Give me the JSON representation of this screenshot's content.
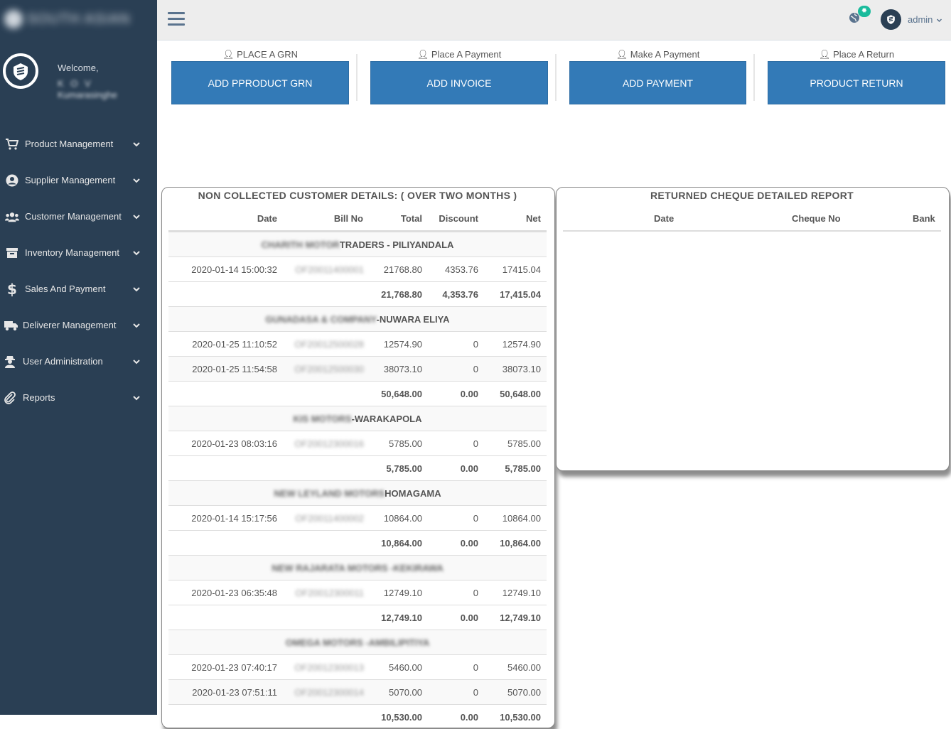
{
  "sidebar": {
    "brand": "SOUTH ASIAN",
    "welcome": "Welcome,",
    "user_line1": "K O V",
    "user_line2": "Kumarasinghe",
    "items": [
      {
        "label": "Product Management"
      },
      {
        "label": "Supplier Management"
      },
      {
        "label": "Customer Management"
      },
      {
        "label": "Inventory Management"
      },
      {
        "label": "Sales And Payment"
      },
      {
        "label": "Deliverer Management"
      },
      {
        "label": "User Administration"
      },
      {
        "label": "Reports"
      }
    ]
  },
  "topbar": {
    "user": "admin",
    "notif_count": "✹"
  },
  "actions": [
    {
      "title": "PLACE A GRN",
      "button": "ADD PPRODUCT GRN"
    },
    {
      "title": "Place A Payment",
      "button": "ADD INVOICE"
    },
    {
      "title": "Make A Payment",
      "button": "ADD PAYMENT"
    },
    {
      "title": "Place A Return",
      "button": "PRODUCT RETURN"
    }
  ],
  "customers_panel": {
    "title": "NON COLLECTED CUSTOMER DETAILS: ( OVER TWO MONTHS )",
    "columns": [
      "Date",
      "Bill No",
      "Total",
      "Discount",
      "Net"
    ],
    "groups": [
      {
        "blur": "CHARITH MOTOR",
        "name": "TRADERS - PILIYANDALA",
        "rows": [
          {
            "date": "2020-01-14 15:00:32",
            "bill": "OF20011400001",
            "total": "21768.80",
            "discount": "4353.76",
            "net": "17415.04"
          }
        ],
        "sum": {
          "total": "21,768.80",
          "discount": "4,353.76",
          "net": "17,415.04"
        }
      },
      {
        "blur": "GUNADASA & COMPANY",
        "name": "-NUWARA ELIYA",
        "rows": [
          {
            "date": "2020-01-25 11:10:52",
            "bill": "OF20012500028",
            "total": "12574.90",
            "discount": "0",
            "net": "12574.90"
          },
          {
            "date": "2020-01-25 11:54:58",
            "bill": "OF20012500030",
            "total": "38073.10",
            "discount": "0",
            "net": "38073.10"
          }
        ],
        "sum": {
          "total": "50,648.00",
          "discount": "0.00",
          "net": "50,648.00"
        }
      },
      {
        "blur": "KIS MOTORS",
        "name": "-WARAKAPOLA",
        "rows": [
          {
            "date": "2020-01-23 08:03:16",
            "bill": "OF20012300016",
            "total": "5785.00",
            "discount": "0",
            "net": "5785.00"
          }
        ],
        "sum": {
          "total": "5,785.00",
          "discount": "0.00",
          "net": "5,785.00"
        }
      },
      {
        "blur": "NEW LEYLAND MOTORS",
        "name": "HOMAGAMA",
        "rows": [
          {
            "date": "2020-01-14 15:17:56",
            "bill": "OF20011400002",
            "total": "10864.00",
            "discount": "0",
            "net": "10864.00"
          }
        ],
        "sum": {
          "total": "10,864.00",
          "discount": "0.00",
          "net": "10,864.00"
        }
      },
      {
        "blur": "NEW RAJARATA MOTORS -KEKIRAWA",
        "name": "",
        "rows": [
          {
            "date": "2020-01-23 06:35:48",
            "bill": "OF20012300011",
            "total": "12749.10",
            "discount": "0",
            "net": "12749.10"
          }
        ],
        "sum": {
          "total": "12,749.10",
          "discount": "0.00",
          "net": "12,749.10"
        }
      },
      {
        "blur": "OMEGA MOTORS -AMBILIPITIYA",
        "name": "",
        "rows": [
          {
            "date": "2020-01-23 07:40:17",
            "bill": "OF20012300013",
            "total": "5460.00",
            "discount": "0",
            "net": "5460.00"
          },
          {
            "date": "2020-01-23 07:51:11",
            "bill": "OF20012300014",
            "total": "5070.00",
            "discount": "0",
            "net": "5070.00"
          }
        ],
        "sum": {
          "total": "10,530.00",
          "discount": "0.00",
          "net": "10,530.00"
        }
      }
    ]
  },
  "cheque_panel": {
    "title": "RETURNED CHEQUE DETAILED REPORT",
    "columns": [
      "Date",
      "Cheque No",
      "Bank"
    ]
  },
  "colors": {
    "sidebar_bg": "#2a3f54",
    "button_blue": "#337ab7",
    "badge_green": "#1abb9c"
  }
}
